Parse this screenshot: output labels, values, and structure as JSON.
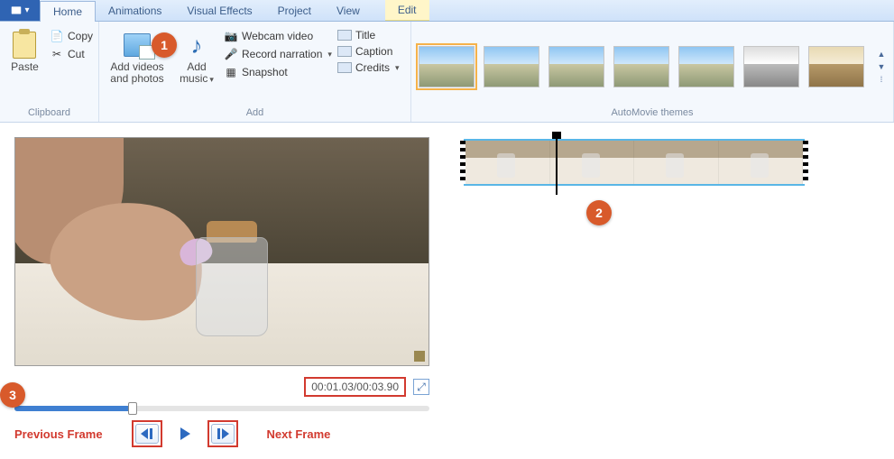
{
  "tabs": {
    "home": "Home",
    "animations": "Animations",
    "visual_effects": "Visual Effects",
    "project": "Project",
    "view": "View",
    "edit": "Edit"
  },
  "clipboard": {
    "paste": "Paste",
    "copy": "Copy",
    "cut": "Cut",
    "group": "Clipboard"
  },
  "add": {
    "add_videos_l1": "Add videos",
    "add_videos_l2": "and photos",
    "add_music_l1": "Add",
    "add_music_l2": "music",
    "webcam": "Webcam video",
    "record": "Record narration",
    "snapshot": "Snapshot",
    "title": "Title",
    "caption": "Caption",
    "credits": "Credits",
    "group": "Add"
  },
  "gallery": {
    "group": "AutoMovie themes"
  },
  "player": {
    "time": "00:01.03/00:03.90",
    "prev": "Previous Frame",
    "next": "Next Frame"
  },
  "annotations": {
    "b1": "1",
    "b2": "2",
    "b3": "3"
  }
}
